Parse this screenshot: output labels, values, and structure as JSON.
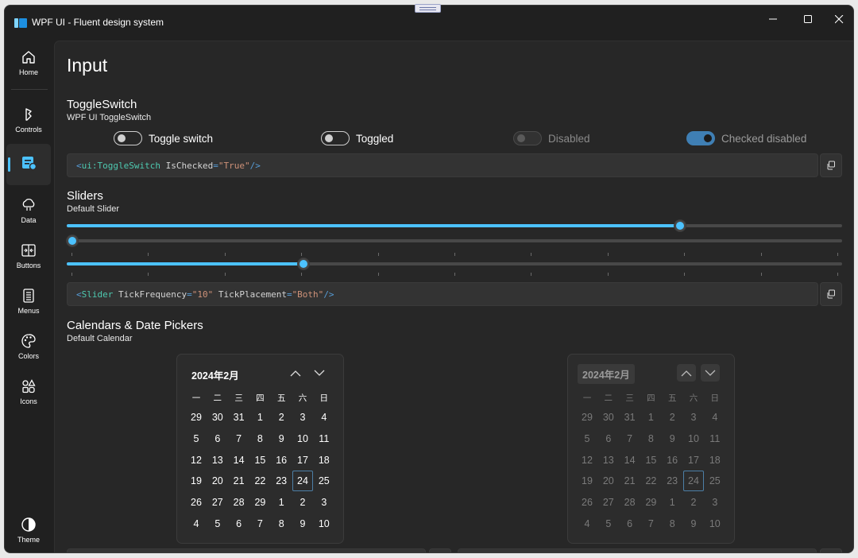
{
  "window": {
    "title": "WPF UI - Fluent design system"
  },
  "nav": {
    "items": [
      {
        "label": "Home",
        "icon": "home-icon"
      },
      {
        "label": "Controls",
        "icon": "controls-icon"
      },
      {
        "label": "",
        "icon": "input-icon",
        "active": true
      },
      {
        "label": "Data",
        "icon": "data-icon"
      },
      {
        "label": "Buttons",
        "icon": "buttons-icon"
      },
      {
        "label": "Menus",
        "icon": "menus-icon"
      },
      {
        "label": "Colors",
        "icon": "colors-icon"
      },
      {
        "label": "Icons",
        "icon": "icons-icon"
      }
    ],
    "theme_label": "Theme"
  },
  "page": {
    "title": "Input"
  },
  "toggle_section": {
    "title": "ToggleSwitch",
    "subtitle": "WPF UI ToggleSwitch",
    "toggles": [
      {
        "label": "Toggle switch",
        "state": "off"
      },
      {
        "label": "Toggled",
        "state": "off"
      },
      {
        "label": "Disabled",
        "state": "disabled"
      },
      {
        "label": "Checked disabled",
        "state": "checked-disabled"
      }
    ],
    "code": {
      "tag": "ui:ToggleSwitch",
      "attr": "IsChecked",
      "value": "\"True\""
    }
  },
  "slider_section": {
    "title": "Sliders",
    "subtitle": "Default Slider",
    "sliders": [
      {
        "value_fraction": 0.795
      },
      {
        "value_fraction": 0.0
      },
      {
        "value_fraction": 0.302,
        "ticks": 10
      }
    ],
    "code": {
      "tag": "Slider",
      "attr1": "TickFrequency",
      "val1": "\"10\"",
      "attr2": "TickPlacement",
      "val2": "\"Both\""
    }
  },
  "calendar_section": {
    "title": "Calendars & Date Pickers",
    "subtitle": "Default Calendar",
    "month_label": "2024年2月",
    "weekdays": [
      "一",
      "二",
      "三",
      "四",
      "五",
      "六",
      "日"
    ],
    "weeks": [
      [
        "29",
        "30",
        "31",
        "1",
        "2",
        "3",
        "4"
      ],
      [
        "5",
        "6",
        "7",
        "8",
        "9",
        "10",
        "11"
      ],
      [
        "12",
        "13",
        "14",
        "15",
        "16",
        "17",
        "18"
      ],
      [
        "19",
        "20",
        "21",
        "22",
        "23",
        "24",
        "25"
      ],
      [
        "26",
        "27",
        "28",
        "29",
        "1",
        "2",
        "3"
      ],
      [
        "4",
        "5",
        "6",
        "7",
        "8",
        "9",
        "10"
      ]
    ],
    "today": "24"
  },
  "colors": {
    "accent": "#4cc2ff",
    "background": "#272727",
    "sidebar": "#202020"
  }
}
